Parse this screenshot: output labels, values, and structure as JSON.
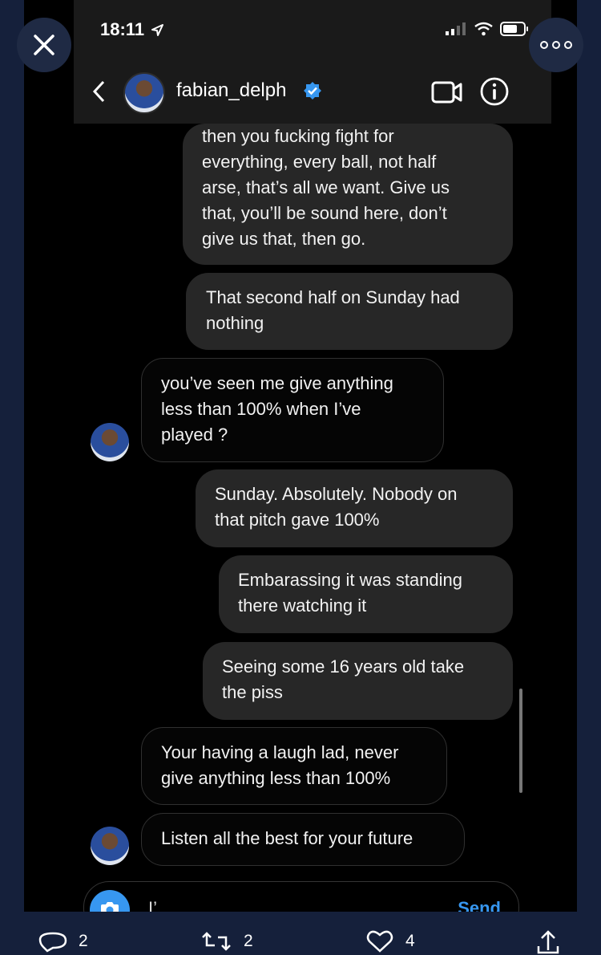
{
  "status_bar": {
    "time": "18:11"
  },
  "header": {
    "username": "fabian_delph"
  },
  "messages": [
    {
      "lines": [
        "then you fucking fight for",
        "everything, every ball, not half",
        "arse, that’s all  we want. Give us",
        "that, you’ll be sound here, don’t",
        "give us that, then go."
      ]
    },
    {
      "lines": [
        "That second half on Sunday had",
        "nothing"
      ]
    },
    {
      "lines": [
        "you’ve seen me give anything",
        "less than 100% when I’ve",
        "played ?"
      ]
    },
    {
      "lines": [
        "Sunday. Absolutely. Nobody on",
        "that pitch gave 100%"
      ]
    },
    {
      "lines": [
        "Embarassing it was standing",
        "there watching it"
      ]
    },
    {
      "lines": [
        "Seeing some 16 years old take",
        "the piss"
      ]
    },
    {
      "lines": [
        "Your having a laugh lad, never",
        "give anything less than 100%"
      ]
    },
    {
      "lines": [
        "Listen all the best for your future"
      ]
    }
  ],
  "composer": {
    "value": "I’",
    "send_label": "Send"
  },
  "tweet_actions": {
    "replies": "2",
    "retweets": "2",
    "likes": "4"
  },
  "icons": {
    "location": "location-arrow-icon",
    "signal": "cellular-signal-icon",
    "wifi": "wifi-icon",
    "battery": "battery-icon",
    "back": "chevron-left-icon",
    "verified": "verified-badge-icon",
    "video": "video-camera-icon",
    "info": "info-icon",
    "camera": "camera-icon",
    "close": "close-icon",
    "more": "more-options-icon",
    "reply": "reply-icon",
    "retweet": "retweet-icon",
    "like": "heart-icon",
    "share": "share-icon"
  },
  "colors": {
    "accent": "#3797f0",
    "outgoing_bubble": "#272727",
    "page_background": "#15203b"
  }
}
